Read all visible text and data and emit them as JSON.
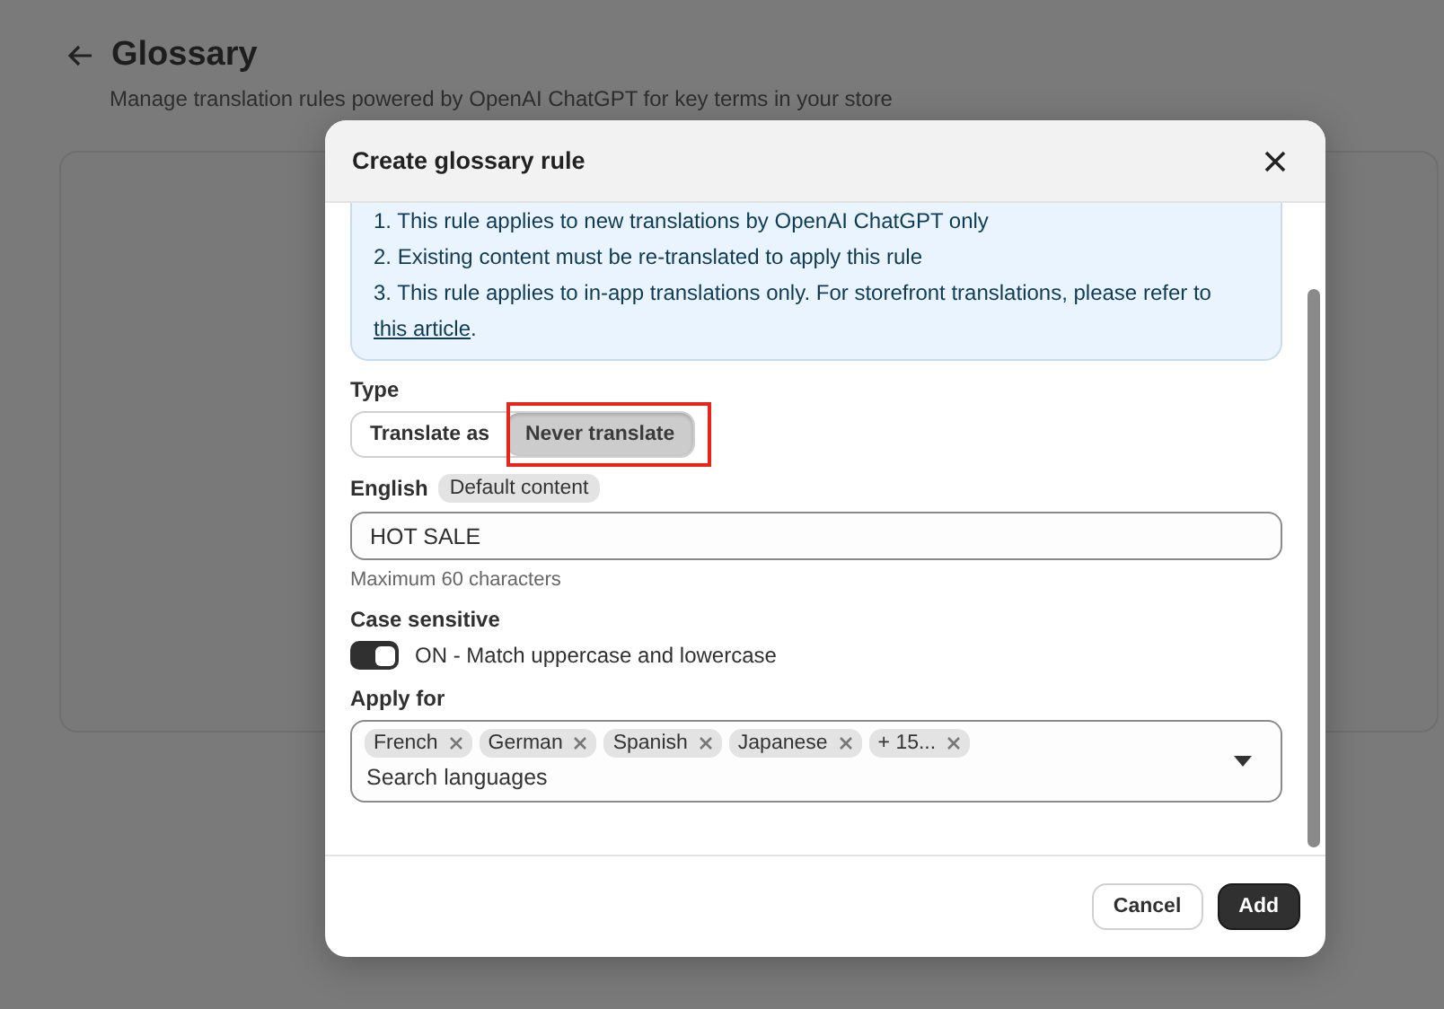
{
  "page": {
    "title": "Glossary",
    "subtitle": "Manage translation rules powered by OpenAI ChatGPT for key terms in your store"
  },
  "dialog": {
    "title": "Create glossary rule",
    "notes": [
      "1. This rule applies to new translations by OpenAI ChatGPT only",
      "2. Existing content must be re-translated to apply this rule",
      {
        "text": "3. This rule applies to in-app translations only. For storefront translations, please refer to ",
        "link": "this article",
        "end": "."
      }
    ],
    "type": {
      "label": "Type",
      "options": [
        {
          "label": "Translate as",
          "selected": false,
          "highlighted": false
        },
        {
          "label": "Never translate",
          "selected": true,
          "highlighted": true
        }
      ]
    },
    "term": {
      "label": "English",
      "badge": "Default content",
      "value": "HOT SALE",
      "hint": "Maximum 60 characters"
    },
    "case_sensitive": {
      "label": "Case sensitive",
      "on": true,
      "text": "ON - Match uppercase and lowercase"
    },
    "apply_for": {
      "label": "Apply for",
      "tags": [
        "French",
        "German",
        "Spanish",
        "Japanese",
        "+ 15..."
      ],
      "placeholder": "Search languages"
    },
    "buttons": [
      {
        "label": "Cancel",
        "kind": "secondary"
      },
      {
        "label": "Add",
        "kind": "primary"
      }
    ]
  }
}
